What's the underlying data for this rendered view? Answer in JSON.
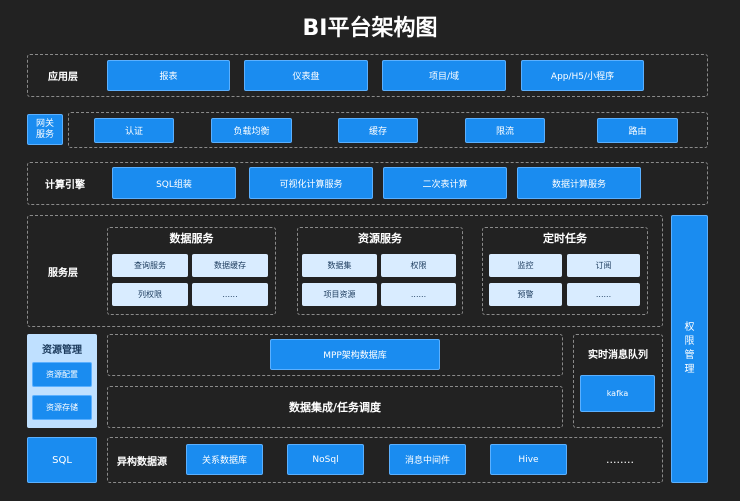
{
  "title": "BI平台架构图",
  "app_layer": {
    "label": "应用层",
    "items": [
      "报表",
      "仪表盘",
      "项目/域",
      "App/H5/小程序"
    ]
  },
  "gateway": {
    "label": "网关\n服务",
    "items": [
      "认证",
      "负载均衡",
      "缓存",
      "限流",
      "路由"
    ]
  },
  "compute": {
    "label": "计算引擎",
    "items": [
      "SQL组装",
      "可视化计算服务",
      "二次表计算",
      "数据计算服务"
    ]
  },
  "service_layer": {
    "label": "服务层",
    "groups": [
      {
        "title": "数据服务",
        "items": [
          "查询服务",
          "数据缓存",
          "列权限",
          "......"
        ]
      },
      {
        "title": "资源服务",
        "items": [
          "数据集",
          "权限",
          "项目资源",
          "......"
        ]
      },
      {
        "title": "定时任务",
        "items": [
          "监控",
          "订阅",
          "预警",
          "......"
        ]
      }
    ]
  },
  "permission": {
    "label": "权\n限\n管\n理"
  },
  "resource_mgmt": {
    "label": "资源管理",
    "items": [
      "资源配置",
      "资源存储"
    ]
  },
  "mpp": {
    "label": "MPP架构数据库"
  },
  "data_integration": {
    "label": "数据集成/任务调度"
  },
  "mq": {
    "label": "实时消息队列",
    "item": "kafka"
  },
  "sql": {
    "label": "SQL"
  },
  "datasource": {
    "label": "异构数据源",
    "items": [
      "关系数据库",
      "NoSql",
      "消息中间件",
      "Hive",
      "........"
    ]
  }
}
